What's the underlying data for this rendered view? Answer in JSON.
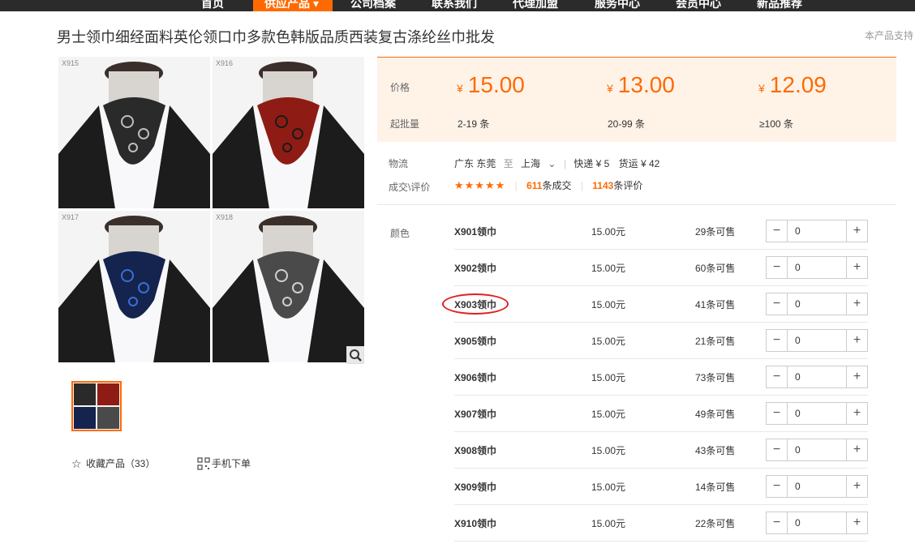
{
  "nav": {
    "items": [
      {
        "label": "首页",
        "active": false
      },
      {
        "label": "供应产品",
        "active": true
      },
      {
        "label": "公司档案",
        "active": false
      },
      {
        "label": "联系我们",
        "active": false
      },
      {
        "label": "代理加盟",
        "active": false
      },
      {
        "label": "服务中心",
        "active": false
      },
      {
        "label": "会员中心",
        "active": false
      },
      {
        "label": "新品推荐",
        "active": false
      }
    ]
  },
  "product": {
    "title": "男士领巾细经面料英伦领口巾多款色韩版品质西装复古涤纶丝巾批发",
    "support_text": "本产品支持"
  },
  "gallery": {
    "cells": [
      {
        "code": "X915",
        "color": "#2a2a2a",
        "pattern": "#bdbdbd"
      },
      {
        "code": "X916",
        "color": "#8e1c14",
        "pattern": "#1a1a1a"
      },
      {
        "code": "X917",
        "color": "#14244f",
        "pattern": "#3a6fd0"
      },
      {
        "code": "X918",
        "color": "#4a4a4a",
        "pattern": "#cfcfcf"
      }
    ],
    "zoom_icon": "magnifier-icon"
  },
  "actions": {
    "favorite_label": "收藏产品（33）",
    "favorite_icon": "star-outline-icon",
    "mobile_label": "手机下单",
    "mobile_icon": "qr-code-icon"
  },
  "pricing": {
    "price_label": "价格",
    "moq_label": "起批量",
    "currency": "¥",
    "tiers": [
      {
        "price": "15.00",
        "qty": "2-19 条"
      },
      {
        "price": "13.00",
        "qty": "20-99 条"
      },
      {
        "price": "12.09",
        "qty": "≥100 条"
      }
    ],
    "accent_color": "#ff6a00"
  },
  "logistics": {
    "label": "物流",
    "from": "广东 东莞",
    "to_word": "至",
    "to": "上海",
    "express": "快递 ¥ 5",
    "freight": "货运 ¥ 42"
  },
  "reviews": {
    "label": "成交\\评价",
    "stars": "★★★★★",
    "deals_count": "611",
    "deals_text": "条成交",
    "review_count": "1143",
    "review_text": "条评价"
  },
  "skus": {
    "label": "颜色",
    "rows": [
      {
        "name": "X901领巾",
        "price": "15.00元",
        "stock": "29条可售",
        "qty": "0"
      },
      {
        "name": "X902领巾",
        "price": "15.00元",
        "stock": "60条可售",
        "qty": "0"
      },
      {
        "name": "X903领巾",
        "price": "15.00元",
        "stock": "41条可售",
        "qty": "0"
      },
      {
        "name": "X905领巾",
        "price": "15.00元",
        "stock": "21条可售",
        "qty": "0"
      },
      {
        "name": "X906领巾",
        "price": "15.00元",
        "stock": "73条可售",
        "qty": "0"
      },
      {
        "name": "X907领巾",
        "price": "15.00元",
        "stock": "49条可售",
        "qty": "0"
      },
      {
        "name": "X908领巾",
        "price": "15.00元",
        "stock": "43条可售",
        "qty": "0"
      },
      {
        "name": "X909领巾",
        "price": "15.00元",
        "stock": "14条可售",
        "qty": "0"
      },
      {
        "name": "X910领巾",
        "price": "15.00元",
        "stock": "22条可售",
        "qty": "0"
      }
    ]
  }
}
